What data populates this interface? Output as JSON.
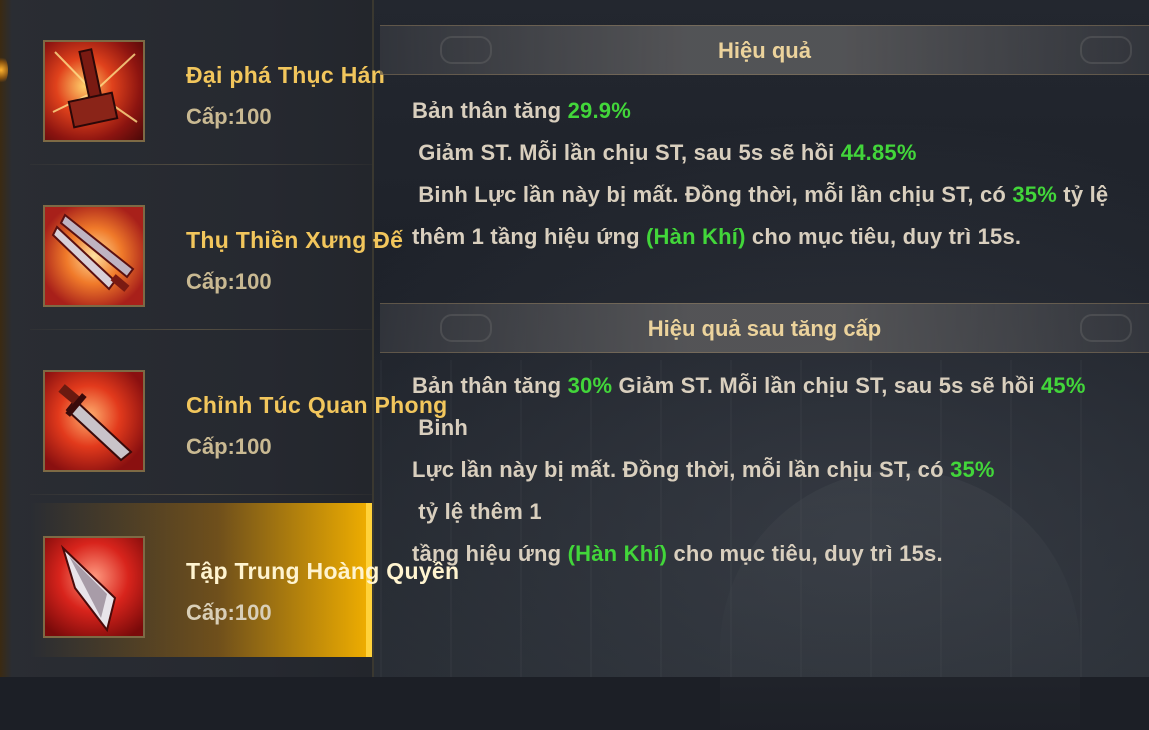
{
  "skills": [
    {
      "name": "Đại phá Thục Hán",
      "level": "Cấp:100",
      "icon": "hammer-icon",
      "selected": false
    },
    {
      "name": "Thụ Thiền Xưng Đế",
      "level": "Cấp:100",
      "icon": "blades-icon",
      "selected": false
    },
    {
      "name": "Chỉnh Túc Quan Phong",
      "level": "Cấp:100",
      "icon": "sword-icon",
      "selected": false
    },
    {
      "name": "Tập Trung Hoàng Quyền",
      "level": "Cấp:100",
      "icon": "spear-icon",
      "selected": true
    }
  ],
  "effect": {
    "title": "Hiệu quả",
    "lines": [
      [
        "Bản thân tăng ",
        {
          "hl": "29.9%"
        },
        " Giảm ST. Mỗi lần chịu ST, sau 5s sẽ hồi ",
        {
          "hl": "44.85%"
        }
      ],
      [
        " Binh Lực lần này bị mất. Đồng thời, mỗi lần chịu ST, có ",
        {
          "hl": "35%"
        },
        " tỷ lệ"
      ],
      [
        "thêm 1 tầng hiệu ứng ",
        {
          "hl": "(Hàn Khí)"
        },
        " cho mục tiêu, duy trì 15s."
      ]
    ]
  },
  "upgrade": {
    "title": "Hiệu quả sau tăng cấp",
    "lines": [
      [
        "Bản thân tăng ",
        {
          "hl": "30%"
        },
        " Giảm ST. Mỗi lần chịu ST, sau 5s sẽ hồi ",
        {
          "hl": "45%"
        },
        " Binh"
      ],
      [
        "Lực lần này bị mất. Đồng thời, mỗi lần chịu ST, có ",
        {
          "hl": "35%"
        },
        " tỷ lệ thêm 1"
      ],
      [
        "tầng hiệu ứng ",
        {
          "hl": "(Hàn Khí)"
        },
        " cho mục tiêu, duy trì 15s."
      ]
    ]
  },
  "colors": {
    "highlight": "#42d63a",
    "skill_name": "#f2c65c",
    "section_title": "#ecd39c",
    "selected_gold": "#f2b000"
  }
}
